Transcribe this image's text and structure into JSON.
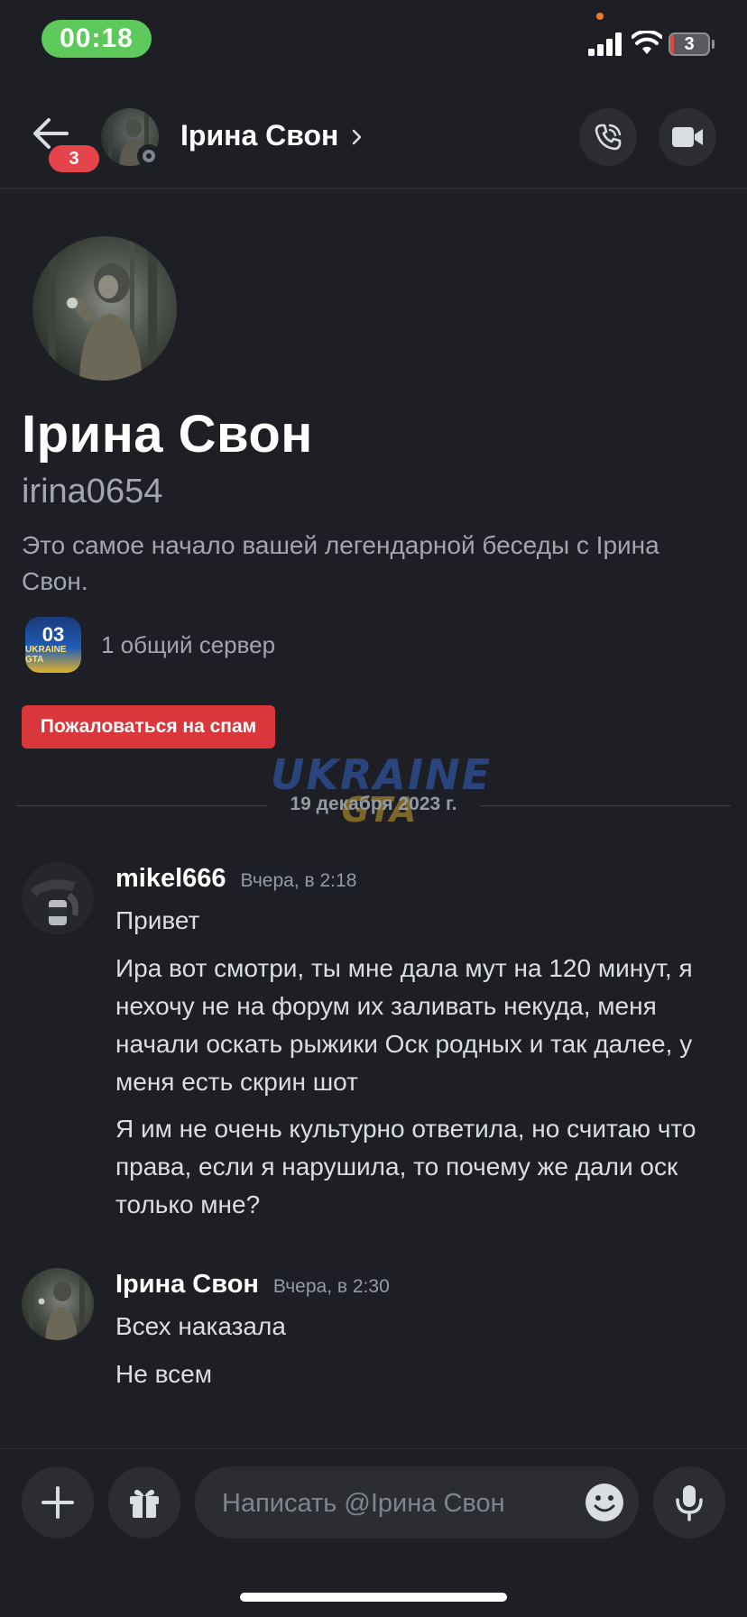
{
  "status_bar": {
    "time": "00:18",
    "battery": "3",
    "accent_time_bg": "#5cc95a"
  },
  "header": {
    "back_badge": "3",
    "contact_name": "Ірина Свон",
    "icons": [
      "back-arrow-icon",
      "chevron-right-icon",
      "phone-call-icon",
      "video-camera-icon"
    ]
  },
  "intro": {
    "display_name": "Ірина Свон",
    "username": "irina0654",
    "description": "Это самое начало вашей легендарной беседы с Ірина Свон.",
    "server_icon_text": "03",
    "server_icon_sub": "UKRAINE GTA",
    "mutual_servers": "1 общий сервер",
    "spam_button": "Пожаловаться на спам",
    "spam_color": "#da373c"
  },
  "date_divider": "19 декабря 2023 г.",
  "watermark": {
    "line1": "UKRAINE",
    "line2": "GTA"
  },
  "messages": [
    {
      "author": "mikel666",
      "time": "Вчера, в 2:18",
      "lines": [
        "Привет",
        "Ира вот смотри, ты мне дала мут на 120 минут, я нехочу не на форум их заливать некуда, меня начали оскать рыжики Оск родных и так далее, у меня есть скрин шот",
        "Я им не очень культурно ответила, но считаю что права, если я нарушила, то почему же дали оск только мне?"
      ]
    },
    {
      "author": "Ірина Свон",
      "time": "Вчера, в 2:30",
      "lines": [
        "Всех наказала",
        "Не всем"
      ]
    }
  ],
  "composer": {
    "placeholder": "Написать @Ірина Свон",
    "icons": [
      "plus-icon",
      "gift-icon",
      "emoji-icon",
      "microphone-icon"
    ]
  }
}
